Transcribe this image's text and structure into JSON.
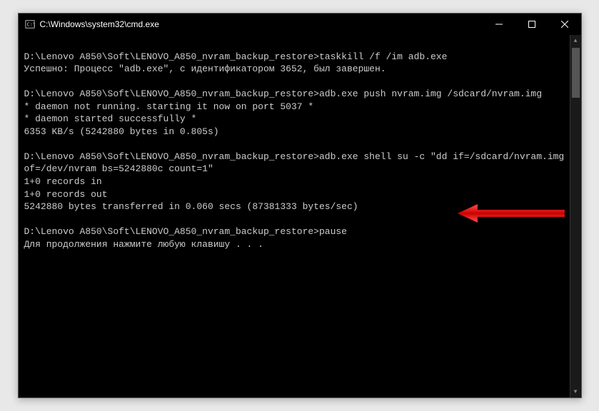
{
  "titlebar": {
    "title": "C:\\Windows\\system32\\cmd.exe"
  },
  "terminal": {
    "lines": [
      "",
      "D:\\Lenovo A850\\Soft\\LENOVO_A850_nvram_backup_restore>taskkill /f /im adb.exe",
      "Успешно: Процесс \"adb.exe\", с идентификатором 3652, был завершен.",
      "",
      "D:\\Lenovo A850\\Soft\\LENOVO_A850_nvram_backup_restore>adb.exe push nvram.img /sdcard/nvram.img",
      "* daemon not running. starting it now on port 5037 *",
      "* daemon started successfully *",
      "6353 KB/s (5242880 bytes in 0.805s)",
      "",
      "D:\\Lenovo A850\\Soft\\LENOVO_A850_nvram_backup_restore>adb.exe shell su -c \"dd if=/sdcard/nvram.img of=/dev/nvram bs=5242880c count=1\"",
      "1+0 records in",
      "1+0 records out",
      "5242880 bytes transferred in 0.060 secs (87381333 bytes/sec)",
      "",
      "D:\\Lenovo A850\\Soft\\LENOVO_A850_nvram_backup_restore>pause",
      "Для продолжения нажмите любую клавишу . . ."
    ]
  },
  "annotation": {
    "arrow_color": "#ff0000"
  }
}
